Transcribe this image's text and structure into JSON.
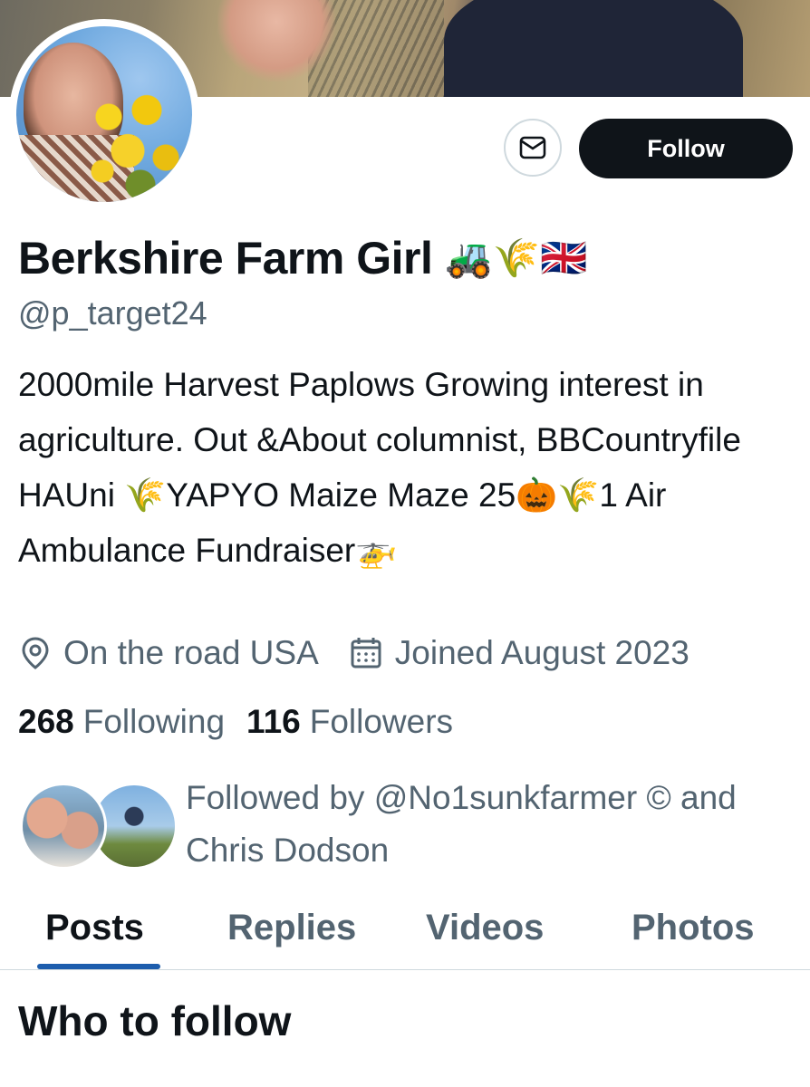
{
  "profile": {
    "display_name": "Berkshire Farm Girl",
    "name_emojis": "🚜🌾🇬🇧",
    "handle": "@p_target24",
    "bio": "2000mile Harvest Paplows Growing interest in agriculture. Out &About columnist, BBCountryfile HAUni 🌾YAPYO Maize Maze 25🎃🌾1 Air Ambulance Fundraiser🚁",
    "location": "On the road USA",
    "joined": "Joined August 2023",
    "following_count": "268",
    "following_label": "Following",
    "followers_count": "116",
    "followers_label": "Followers",
    "followed_by": "Followed by @No1sunkfarmer © and Chris Dodson"
  },
  "actions": {
    "follow_label": "Follow",
    "message_icon": "envelope-icon"
  },
  "icons": {
    "location": "location-pin-icon",
    "joined": "calendar-icon"
  },
  "tabs": [
    {
      "label": "Posts",
      "active": true
    },
    {
      "label": "Replies",
      "active": false
    },
    {
      "label": "Videos",
      "active": false
    },
    {
      "label": "Photos",
      "active": false
    }
  ],
  "sections": {
    "who_to_follow": "Who to follow"
  },
  "colors": {
    "text_primary": "#0f1419",
    "text_secondary": "#536471",
    "follow_button_bg": "#0f1419",
    "active_tab_indicator": "#1d5dad",
    "border": "#cfd9de"
  }
}
